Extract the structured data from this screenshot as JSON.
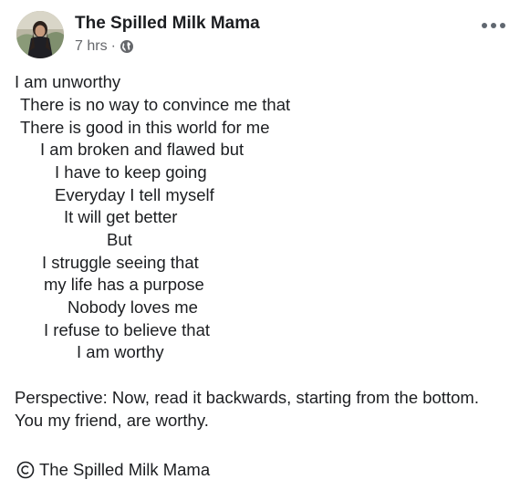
{
  "post": {
    "author": "The Spilled Milk Mama",
    "time": "7 hrs",
    "separator": "·",
    "privacy_icon": "globe-icon",
    "more_icon": "more-options-icon",
    "avatar_icon": "profile-photo"
  },
  "poem": [
    "I am unworthy",
    "There is no way to convince me that",
    "There is good in this world for me",
    "I am broken and flawed but",
    "I have to keep going",
    "Everyday I tell myself",
    "It will get better",
    "But",
    "I struggle seeing that",
    "my life has a purpose",
    "Nobody loves me",
    "I refuse to believe that",
    "I am worthy"
  ],
  "perspective": "Perspective: Now, read it backwards, starting from the bottom. You my friend, are worthy.",
  "copyright": {
    "icon": "copyright-icon",
    "text": "The Spilled Milk Mama"
  },
  "colors": {
    "text": "#1c1e21",
    "secondary": "#65676b",
    "background": "#ffffff"
  }
}
